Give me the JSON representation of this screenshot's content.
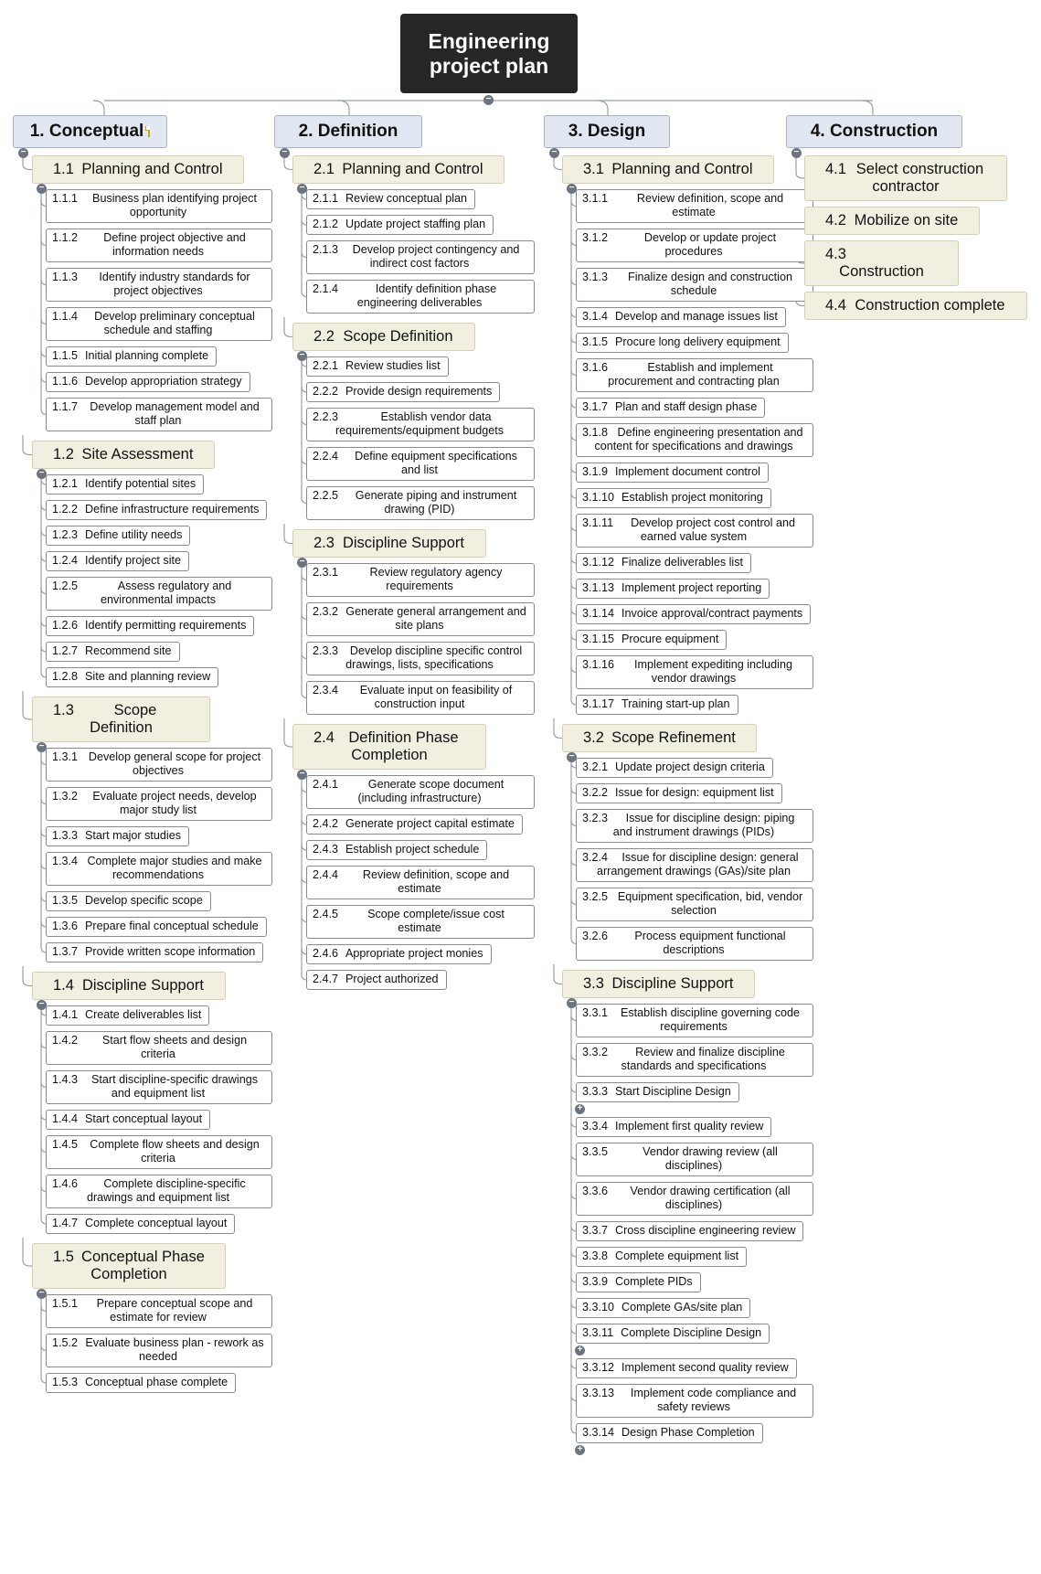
{
  "root": {
    "title": "Engineering\nproject plan"
  },
  "phases": [
    {
      "label": "1.  Conceptual",
      "has_note": true,
      "subs": [
        {
          "num": "1.1",
          "label": "Planning and Control",
          "tasks": [
            {
              "num": "1.1.1",
              "label": "Business plan identifying project opportunity"
            },
            {
              "num": "1.1.2",
              "label": "Define project objective and information needs"
            },
            {
              "num": "1.1.3",
              "label": "Identify industry standards for project objectives"
            },
            {
              "num": "1.1.4",
              "label": "Develop preliminary conceptual schedule and staffing"
            },
            {
              "num": "1.1.5",
              "label": "Initial planning complete"
            },
            {
              "num": "1.1.6",
              "label": "Develop appropriation strategy"
            },
            {
              "num": "1.1.7",
              "label": "Develop management model and staff plan"
            }
          ]
        },
        {
          "num": "1.2",
          "label": "Site Assessment",
          "tasks": [
            {
              "num": "1.2.1",
              "label": "Identify potential sites"
            },
            {
              "num": "1.2.2",
              "label": "Define infrastructure requirements"
            },
            {
              "num": "1.2.3",
              "label": "Define utility needs"
            },
            {
              "num": "1.2.4",
              "label": "Identify project site"
            },
            {
              "num": "1.2.5",
              "label": "Assess regulatory and environmental impacts"
            },
            {
              "num": "1.2.6",
              "label": "Identify permitting requirements"
            },
            {
              "num": "1.2.7",
              "label": "Recommend site"
            },
            {
              "num": "1.2.8",
              "label": "Site and planning review"
            }
          ]
        },
        {
          "num": "1.3",
          "label": "Scope Definition",
          "tasks": [
            {
              "num": "1.3.1",
              "label": "Develop general scope for project objectives"
            },
            {
              "num": "1.3.2",
              "label": "Evaluate project needs, develop major study list"
            },
            {
              "num": "1.3.3",
              "label": "Start major studies"
            },
            {
              "num": "1.3.4",
              "label": "Complete major studies and make recommendations"
            },
            {
              "num": "1.3.5",
              "label": "Develop specific scope"
            },
            {
              "num": "1.3.6",
              "label": "Prepare final conceptual schedule"
            },
            {
              "num": "1.3.7",
              "label": "Provide written scope information"
            }
          ]
        },
        {
          "num": "1.4",
          "label": "Discipline Support",
          "tasks": [
            {
              "num": "1.4.1",
              "label": "Create deliverables list"
            },
            {
              "num": "1.4.2",
              "label": "Start flow sheets and design criteria"
            },
            {
              "num": "1.4.3",
              "label": "Start discipline-specific drawings and equipment list"
            },
            {
              "num": "1.4.4",
              "label": "Start conceptual layout"
            },
            {
              "num": "1.4.5",
              "label": "Complete flow sheets and design criteria"
            },
            {
              "num": "1.4.6",
              "label": "Complete discipline-specific drawings and equipment list"
            },
            {
              "num": "1.4.7",
              "label": "Complete conceptual layout"
            }
          ]
        },
        {
          "num": "1.5",
          "label": "Conceptual Phase Completion",
          "tasks": [
            {
              "num": "1.5.1",
              "label": "Prepare conceptual scope and estimate for review"
            },
            {
              "num": "1.5.2",
              "label": "Evaluate business plan - rework as needed"
            },
            {
              "num": "1.5.3",
              "label": "Conceptual phase complete"
            }
          ]
        }
      ]
    },
    {
      "label": "2.  Definition",
      "has_note": false,
      "subs": [
        {
          "num": "2.1",
          "label": "Planning and Control",
          "tasks": [
            {
              "num": "2.1.1",
              "label": "Review conceptual plan"
            },
            {
              "num": "2.1.2",
              "label": "Update project staffing plan"
            },
            {
              "num": "2.1.3",
              "label": "Develop project contingency and indirect cost factors"
            },
            {
              "num": "2.1.4",
              "label": "Identify definition phase engineering deliverables"
            }
          ]
        },
        {
          "num": "2.2",
          "label": "Scope Definition",
          "tasks": [
            {
              "num": "2.2.1",
              "label": "Review studies list"
            },
            {
              "num": "2.2.2",
              "label": "Provide design requirements"
            },
            {
              "num": "2.2.3",
              "label": "Establish vendor data requirements/equipment budgets"
            },
            {
              "num": "2.2.4",
              "label": "Define equipment specifications and list"
            },
            {
              "num": "2.2.5",
              "label": "Generate piping and instrument drawing (PID)"
            }
          ]
        },
        {
          "num": "2.3",
          "label": "Discipline Support",
          "tasks": [
            {
              "num": "2.3.1",
              "label": "Review regulatory agency requirements"
            },
            {
              "num": "2.3.2",
              "label": "Generate general arrangement and site plans"
            },
            {
              "num": "2.3.3",
              "label": "Develop discipline specific control drawings, lists, specifications"
            },
            {
              "num": "2.3.4",
              "label": "Evaluate input on feasibility of construction input"
            }
          ]
        },
        {
          "num": "2.4",
          "label": "Definition Phase Completion",
          "tasks": [
            {
              "num": "2.4.1",
              "label": "Generate scope document (including infrastructure)"
            },
            {
              "num": "2.4.2",
              "label": "Generate project capital estimate"
            },
            {
              "num": "2.4.3",
              "label": "Establish project schedule"
            },
            {
              "num": "2.4.4",
              "label": "Review definition, scope and estimate"
            },
            {
              "num": "2.4.5",
              "label": "Scope complete/issue cost estimate"
            },
            {
              "num": "2.4.6",
              "label": "Appropriate project monies"
            },
            {
              "num": "2.4.7",
              "label": "Project authorized"
            }
          ]
        }
      ]
    },
    {
      "label": "3.  Design",
      "has_note": false,
      "subs": [
        {
          "num": "3.1",
          "label": "Planning and Control",
          "tasks": [
            {
              "num": "3.1.1",
              "label": "Review definition, scope and estimate"
            },
            {
              "num": "3.1.2",
              "label": "Develop or update project procedures"
            },
            {
              "num": "3.1.3",
              "label": "Finalize design and construction schedule"
            },
            {
              "num": "3.1.4",
              "label": "Develop and manage issues list"
            },
            {
              "num": "3.1.5",
              "label": "Procure long delivery equipment"
            },
            {
              "num": "3.1.6",
              "label": "Establish and implement procurement and contracting plan"
            },
            {
              "num": "3.1.7",
              "label": "Plan and staff design phase"
            },
            {
              "num": "3.1.8",
              "label": "Define engineering presentation and content for specifications and drawings"
            },
            {
              "num": "3.1.9",
              "label": "Implement document control"
            },
            {
              "num": "3.1.10",
              "label": "Establish project monitoring"
            },
            {
              "num": "3.1.11",
              "label": "Develop project cost control and earned value system"
            },
            {
              "num": "3.1.12",
              "label": "Finalize deliverables list"
            },
            {
              "num": "3.1.13",
              "label": "Implement project reporting"
            },
            {
              "num": "3.1.14",
              "label": "Invoice approval/contract payments"
            },
            {
              "num": "3.1.15",
              "label": "Procure equipment"
            },
            {
              "num": "3.1.16",
              "label": "Implement expediting including vendor drawings"
            },
            {
              "num": "3.1.17",
              "label": "Training start-up plan"
            }
          ]
        },
        {
          "num": "3.2",
          "label": "Scope Refinement",
          "tasks": [
            {
              "num": "3.2.1",
              "label": "Update project design criteria"
            },
            {
              "num": "3.2.2",
              "label": "Issue for design: equipment list"
            },
            {
              "num": "3.2.3",
              "label": "Issue for discipline design: piping and instrument drawings (PIDs)"
            },
            {
              "num": "3.2.4",
              "label": "Issue for discipline design: general arrangement drawings (GAs)/site plan"
            },
            {
              "num": "3.2.5",
              "label": "Equipment specification, bid, vendor selection"
            },
            {
              "num": "3.2.6",
              "label": "Process equipment functional descriptions"
            }
          ]
        },
        {
          "num": "3.3",
          "label": "Discipline Support",
          "tasks": [
            {
              "num": "3.3.1",
              "label": "Establish discipline governing code requirements"
            },
            {
              "num": "3.3.2",
              "label": "Review and finalize discipline standards and specifications"
            },
            {
              "num": "3.3.3",
              "label": "Start Discipline Design",
              "collapsed": true
            },
            {
              "num": "3.3.4",
              "label": "Implement first quality review"
            },
            {
              "num": "3.3.5",
              "label": "Vendor drawing review (all disciplines)"
            },
            {
              "num": "3.3.6",
              "label": "Vendor drawing certification (all disciplines)"
            },
            {
              "num": "3.3.7",
              "label": "Cross discipline engineering review"
            },
            {
              "num": "3.3.8",
              "label": "Complete equipment list"
            },
            {
              "num": "3.3.9",
              "label": "Complete PIDs"
            },
            {
              "num": "3.3.10",
              "label": "Complete GAs/site plan"
            },
            {
              "num": "3.3.11",
              "label": "Complete Discipline Design",
              "collapsed": true
            },
            {
              "num": "3.3.12",
              "label": "Implement second quality review"
            },
            {
              "num": "3.3.13",
              "label": "Implement code compliance and safety reviews"
            },
            {
              "num": "3.3.14",
              "label": "Design Phase Completion",
              "collapsed": true
            }
          ]
        }
      ]
    },
    {
      "label": "4.  Construction",
      "has_note": false,
      "subs": [
        {
          "num": "4.1",
          "label": "Select construction contractor",
          "tasks": []
        },
        {
          "num": "4.2",
          "label": "Mobilize on site",
          "tasks": []
        },
        {
          "num": "4.3",
          "label": "Construction",
          "tasks": []
        },
        {
          "num": "4.4",
          "label": "Construction complete",
          "tasks": []
        }
      ]
    }
  ],
  "toggles": {
    "expanded": "−",
    "collapsed": "+"
  }
}
